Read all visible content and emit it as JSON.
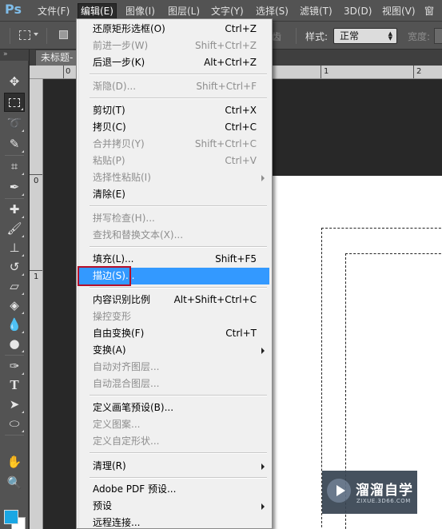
{
  "app": {
    "logo": "Ps"
  },
  "menubar": {
    "items": [
      {
        "label": "文件(F)"
      },
      {
        "label": "编辑(E)"
      },
      {
        "label": "图像(I)"
      },
      {
        "label": "图层(L)"
      },
      {
        "label": "文字(Y)"
      },
      {
        "label": "选择(S)"
      },
      {
        "label": "滤镜(T)"
      },
      {
        "label": "3D(D)"
      },
      {
        "label": "视图(V)"
      },
      {
        "label": "窗"
      }
    ],
    "active": "编辑(E)"
  },
  "options_bar": {
    "partial_label": "消除锯齿",
    "partial_visible": "齿",
    "style_label": "样式:",
    "style_value": "正常",
    "width_label": "宽度:"
  },
  "document": {
    "tab_title": "未标题-"
  },
  "rulers": {
    "h_labels": [
      "0",
      "1",
      "2"
    ],
    "v_labels": [
      "0",
      "1"
    ]
  },
  "tools": {
    "icons": [
      "move-icon",
      "rectangular-marquee-icon",
      "lasso-icon",
      "quick-selection-icon",
      "crop-icon",
      "eyedropper-icon",
      "spot-healing-icon",
      "brush-icon",
      "clone-stamp-icon",
      "history-brush-icon",
      "eraser-icon",
      "paint-bucket-icon",
      "blur-icon",
      "dodge-icon",
      "pen-icon",
      "type-icon",
      "path-selection-icon",
      "ellipse-icon",
      "hand-icon",
      "zoom-icon"
    ],
    "type_glyph": "T",
    "foreground_color": "#1aa7e4",
    "background_color": "#ffffff"
  },
  "edit_menu": {
    "items": [
      {
        "label": "还原矩形选框(O)",
        "shortcut": "Ctrl+Z",
        "disabled": false
      },
      {
        "label": "前进一步(W)",
        "shortcut": "Shift+Ctrl+Z",
        "disabled": true
      },
      {
        "label": "后退一步(K)",
        "shortcut": "Alt+Ctrl+Z",
        "disabled": false
      },
      {
        "label": "渐隐(D)...",
        "shortcut": "Shift+Ctrl+F",
        "disabled": true
      },
      {
        "label": "剪切(T)",
        "shortcut": "Ctrl+X",
        "disabled": false
      },
      {
        "label": "拷贝(C)",
        "shortcut": "Ctrl+C",
        "disabled": false
      },
      {
        "label": "合并拷贝(Y)",
        "shortcut": "Shift+Ctrl+C",
        "disabled": true
      },
      {
        "label": "粘贴(P)",
        "shortcut": "Ctrl+V",
        "disabled": true
      },
      {
        "label": "选择性粘贴(I)",
        "shortcut": "",
        "disabled": true,
        "submenu": true
      },
      {
        "label": "清除(E)",
        "shortcut": "",
        "disabled": false
      },
      {
        "label": "拼写检查(H)...",
        "shortcut": "",
        "disabled": true
      },
      {
        "label": "查找和替换文本(X)...",
        "shortcut": "",
        "disabled": true
      },
      {
        "label": "填充(L)...",
        "shortcut": "Shift+F5",
        "disabled": false
      },
      {
        "label": "描边(S)...",
        "shortcut": "",
        "disabled": false,
        "highlighted": true
      },
      {
        "label": "内容识别比例",
        "shortcut": "Alt+Shift+Ctrl+C",
        "disabled": false
      },
      {
        "label": "操控变形",
        "shortcut": "",
        "disabled": true
      },
      {
        "label": "自由变换(F)",
        "shortcut": "Ctrl+T",
        "disabled": false
      },
      {
        "label": "变换(A)",
        "shortcut": "",
        "disabled": false,
        "submenu": true
      },
      {
        "label": "自动对齐图层...",
        "shortcut": "",
        "disabled": true
      },
      {
        "label": "自动混合图层...",
        "shortcut": "",
        "disabled": true
      },
      {
        "label": "定义画笔预设(B)...",
        "shortcut": "",
        "disabled": false
      },
      {
        "label": "定义图案...",
        "shortcut": "",
        "disabled": true
      },
      {
        "label": "定义自定形状...",
        "shortcut": "",
        "disabled": true
      },
      {
        "label": "清理(R)",
        "shortcut": "",
        "disabled": false,
        "submenu": true
      },
      {
        "label": "Adobe PDF 预设...",
        "shortcut": "",
        "disabled": false
      },
      {
        "label": "预设",
        "shortcut": "",
        "disabled": false,
        "submenu": true
      },
      {
        "label": "远程连接...",
        "shortcut": "",
        "disabled": false
      }
    ],
    "highlight_color": "#3399ff",
    "callout_color": "#b50f2a"
  },
  "watermark": {
    "title": "溜溜自学",
    "url": "ZIXUE.3D66.COM"
  }
}
